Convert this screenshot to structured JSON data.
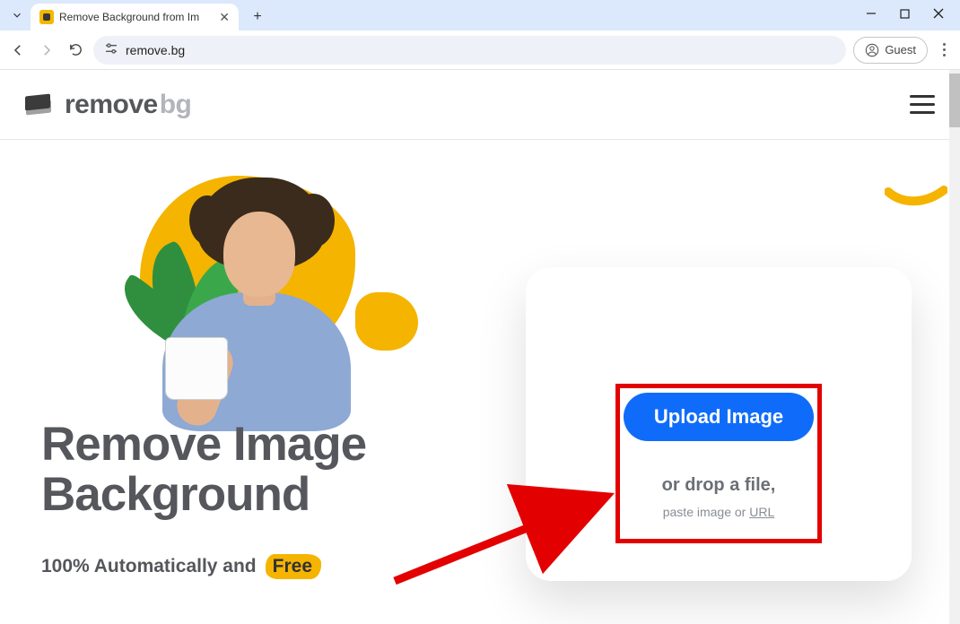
{
  "browser": {
    "tab_title": "Remove Background from Im",
    "url": "remove.bg",
    "guest_label": "Guest"
  },
  "site": {
    "brand_remove": "remove",
    "brand_bg": "bg"
  },
  "hero": {
    "headline_line1": "Remove Image",
    "headline_line2": "Background",
    "subhead_prefix": "100% Automatically and",
    "subhead_badge": "Free"
  },
  "upload": {
    "button_label": "Upload Image",
    "drop_text": "or drop a file,",
    "paste_prefix": "paste image or ",
    "paste_url": "URL"
  }
}
